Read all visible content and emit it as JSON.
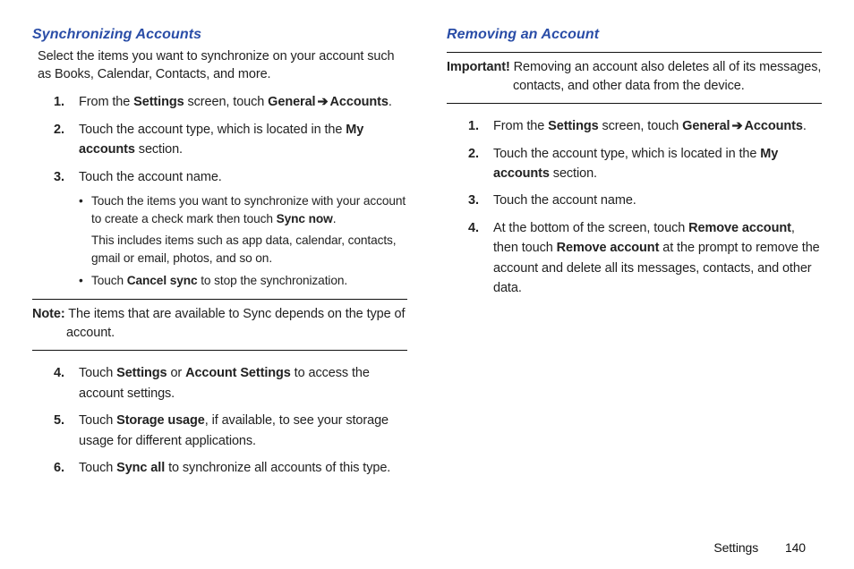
{
  "left": {
    "heading": "Synchronizing Accounts",
    "intro": "Select the items you want to synchronize on your account such as Books, Calendar, Contacts, and more.",
    "step1_a": "From the ",
    "step1_b": "Settings",
    "step1_c": " screen, touch ",
    "step1_d": "General",
    "step1_arrow": "➔",
    "step1_e": "Accounts",
    "step1_f": ".",
    "step2_a": "Touch the account type, which is located in the ",
    "step2_b": "My accounts",
    "step2_c": " section.",
    "step3": "Touch the account name.",
    "sub1_a": "Touch the items you want to synchronize with your account to create a check mark then touch ",
    "sub1_b": "Sync now",
    "sub1_c": ".",
    "sub1_note": "This includes items such as app data, calendar, contacts, gmail or email, photos, and so on.",
    "sub2_a": "Touch ",
    "sub2_b": "Cancel sync",
    "sub2_c": " to stop the synchronization.",
    "note_label": "Note:",
    "note_body": " The items that are available to Sync depends on the type of account.",
    "step4_a": "Touch ",
    "step4_b": "Settings",
    "step4_c": " or ",
    "step4_d": "Account Settings",
    "step4_e": " to access the account settings.",
    "step5_a": "Touch ",
    "step5_b": "Storage usage",
    "step5_c": ", if available, to see your storage usage for different applications.",
    "step6_a": "Touch ",
    "step6_b": "Sync all",
    "step6_c": " to synchronize all accounts of this type."
  },
  "right": {
    "heading": "Removing an Account",
    "important_label": "Important!",
    "important_body": " Removing an account also deletes all of its messages, contacts, and other data from the device.",
    "step1_a": "From the ",
    "step1_b": "Settings",
    "step1_c": " screen, touch ",
    "step1_d": "General",
    "step1_arrow": "➔",
    "step1_e": "Accounts",
    "step1_f": ".",
    "step2_a": "Touch the account type, which is located in the ",
    "step2_b": "My accounts",
    "step2_c": " section.",
    "step3": "Touch the account name.",
    "step4_a": "At the bottom of the screen, touch ",
    "step4_b": "Remove account",
    "step4_c": ", then touch ",
    "step4_d": "Remove account",
    "step4_e": " at the prompt to remove the account and delete all its messages, contacts, and other data."
  },
  "footer": {
    "section": "Settings",
    "page": "140"
  },
  "nums": {
    "n1": "1.",
    "n2": "2.",
    "n3": "3.",
    "n4": "4.",
    "n5": "5.",
    "n6": "6."
  },
  "bullet": "•"
}
